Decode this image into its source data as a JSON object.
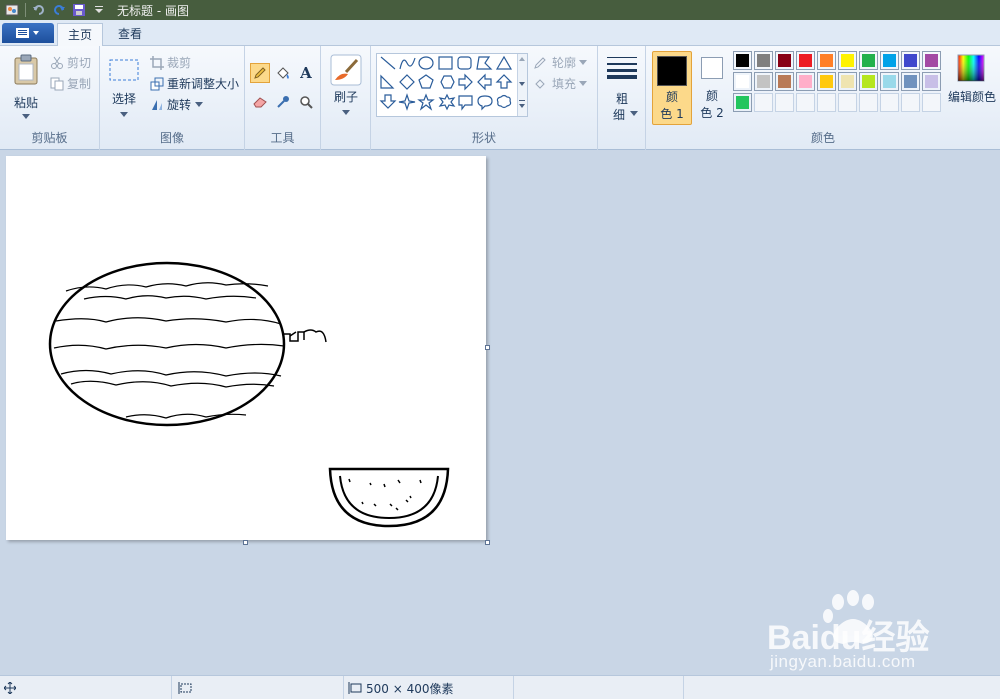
{
  "window": {
    "title": "无标题 - 画图"
  },
  "tabs": [
    {
      "label": "主页"
    },
    {
      "label": "查看"
    }
  ],
  "clipboard": {
    "paste_label": "粘贴",
    "cut_label": "剪切",
    "copy_label": "复制",
    "group_label": "剪贴板"
  },
  "image": {
    "select_label": "选择",
    "crop_label": "裁剪",
    "resize_label": "重新调整大小",
    "rotate_label": "旋转",
    "group_label": "图像"
  },
  "tools": {
    "group_label": "工具",
    "text_glyph": "A"
  },
  "brushes": {
    "label": "刷子"
  },
  "shapes": {
    "outline_label": "轮廓",
    "fill_label": "填充",
    "group_label": "形状"
  },
  "size": {
    "label_line1": "粗",
    "label_line2": "细"
  },
  "colors": {
    "color1_line1": "颜",
    "color1_line2": "色 1",
    "color2_line1": "颜",
    "color2_line2": "色 2",
    "edit_label": "编辑颜色",
    "group_label": "颜色",
    "color1_value": "#000000",
    "color2_value": "#ffffff",
    "palette_row1": [
      "#000000",
      "#7f7f7f",
      "#880015",
      "#ed1c24",
      "#ff7f27",
      "#fff200",
      "#22b14c",
      "#00a2e8",
      "#3f48cc",
      "#a349a4"
    ],
    "palette_row2": [
      "#ffffff",
      "#c3c3c3",
      "#b97a57",
      "#ffaec9",
      "#ffc90e",
      "#efe4b0",
      "#b5e61d",
      "#99d9ea",
      "#7092be",
      "#c8bfe7"
    ],
    "palette_row3": [
      "#22c55e",
      "",
      "",
      "",
      "",
      "",
      "",
      "",
      "",
      ""
    ]
  },
  "status": {
    "canvas_size": "500 × 400像素"
  },
  "watermark": {
    "brand": "Baidu经验",
    "url": "jingyan.baidu.com"
  }
}
